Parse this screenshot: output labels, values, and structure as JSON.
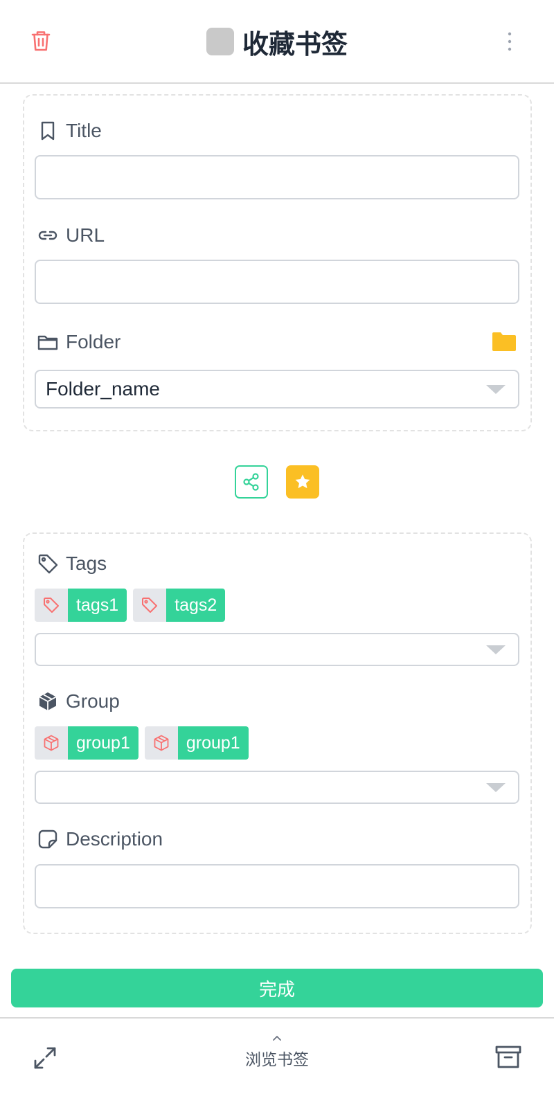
{
  "header": {
    "title": "收藏书签",
    "accent": "#f87171"
  },
  "form": {
    "title_label": "Title",
    "title_value": "",
    "url_label": "URL",
    "url_value": "",
    "folder_label": "Folder",
    "folder_value": "Folder_name",
    "tags_label": "Tags",
    "tags": [
      "tags1",
      "tags2"
    ],
    "group_label": "Group",
    "groups": [
      "group1",
      "group1"
    ],
    "description_label": "Description",
    "description_value": ""
  },
  "actions": {
    "share_icon": "share-icon",
    "star_icon": "star-icon",
    "star_color": "#fbbf24"
  },
  "submit": {
    "label": "完成",
    "color": "#34d399"
  },
  "footer": {
    "browse_label": "浏览书签"
  }
}
